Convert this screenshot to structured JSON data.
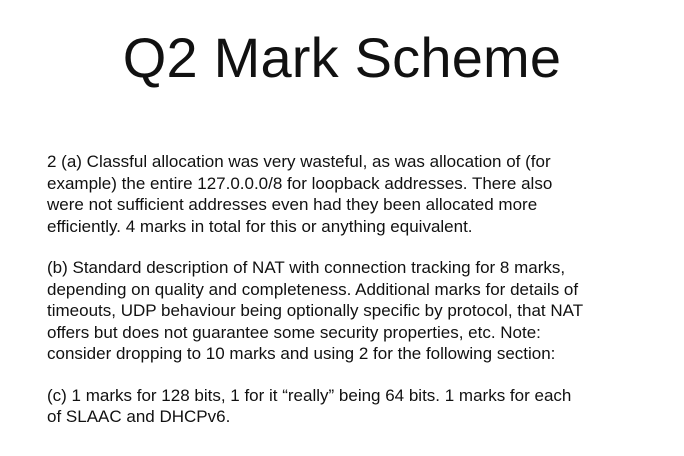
{
  "slide": {
    "title": "Q2 Mark Scheme",
    "paragraphs": [
      {
        "lines": [
          "2 (a) Classful allocation was very wasteful, as was allocation of (for",
          "example) the entire 127.0.0.0/8 for loopback addresses.  There also",
          "were not sufficient addresses even had they been allocated more",
          "efficiently.  4 marks in total for this or anything equivalent."
        ]
      },
      {
        "lines": [
          "(b) Standard description of NAT with connection tracking for 8 marks,",
          "depending on quality and completeness.  Additional marks for details of",
          "timeouts, UDP behaviour being optionally specific by protocol, that NAT",
          "offers but does not guarantee some security properties, etc.  Note:",
          "consider dropping to 10 marks and using 2 for the following section:"
        ]
      },
      {
        "lines": [
          "(c) 1 marks for 128 bits, 1 for it “really” being 64 bits.  1 marks for each",
          "of SLAAC and DHCPv6."
        ]
      }
    ]
  }
}
